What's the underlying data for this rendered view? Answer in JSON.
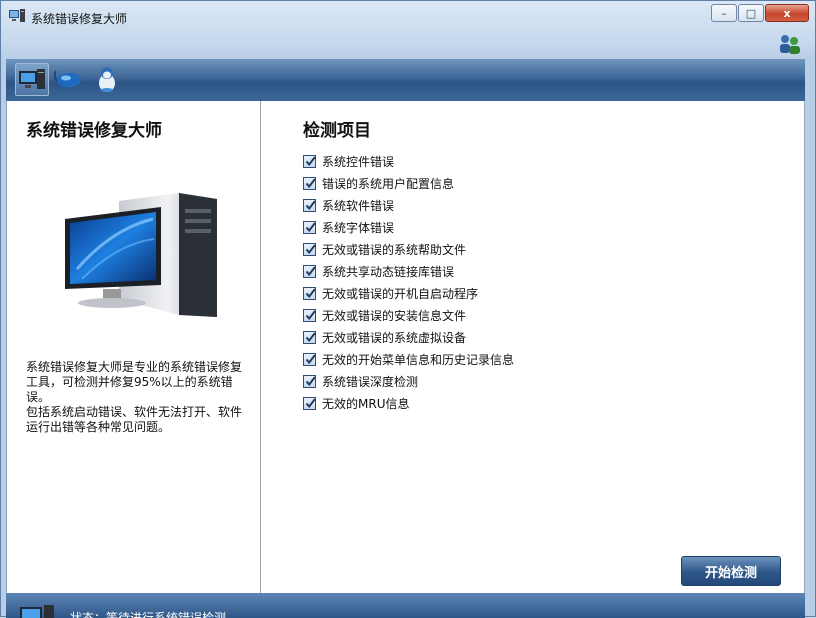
{
  "window": {
    "title": "系统错误修复大师",
    "controls": {
      "minimize": "–",
      "maximize": "□",
      "close": "x"
    }
  },
  "toolbar": {
    "buttons": [
      {
        "name": "computer-icon",
        "active": true
      },
      {
        "name": "mouse-icon",
        "active": false
      },
      {
        "name": "qq-penguin-icon",
        "active": false
      }
    ]
  },
  "left_panel": {
    "title": "系统错误修复大师",
    "description": [
      "系统错误修复大师是专业的系统错误修复工具，可检测并修复95%以上的系统错误。",
      "包括系统启动错误、软件无法打开、软件运行出错等各种常见问题。"
    ]
  },
  "right_panel": {
    "title": "检测项目",
    "items": [
      {
        "label": "系统控件错误",
        "checked": true
      },
      {
        "label": "错误的系统用户配置信息",
        "checked": true
      },
      {
        "label": "系统软件错误",
        "checked": true
      },
      {
        "label": "系统字体错误",
        "checked": true
      },
      {
        "label": "无效或错误的系统帮助文件",
        "checked": true
      },
      {
        "label": "系统共享动态链接库错误",
        "checked": true
      },
      {
        "label": "无效或错误的开机自启动程序",
        "checked": true
      },
      {
        "label": "无效或错误的安装信息文件",
        "checked": true
      },
      {
        "label": "无效或错误的系统虚拟设备",
        "checked": true
      },
      {
        "label": "无效的开始菜单信息和历史记录信息",
        "checked": true
      },
      {
        "label": "系统错误深度检测",
        "checked": true
      },
      {
        "label": "无效的MRU信息",
        "checked": true
      }
    ],
    "start_button": "开始检测"
  },
  "status": {
    "text": "状态：等待进行系统错误检测"
  },
  "colors": {
    "toolbar": "#3e6797",
    "accent_button": "#2e5687",
    "checkbox_border": "#2d4f78"
  }
}
